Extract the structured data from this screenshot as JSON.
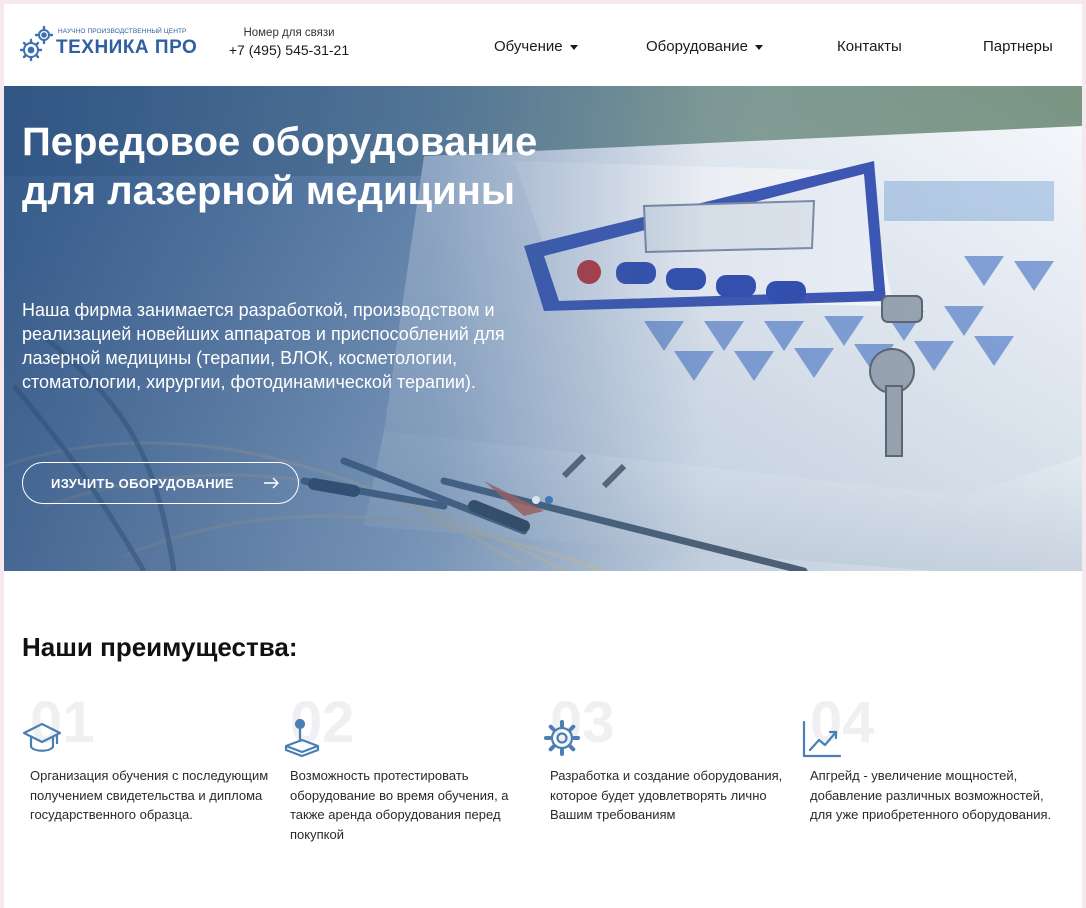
{
  "header": {
    "logo": {
      "small": "НАУЧНО ПРОИЗВОДСТВЕННЫЙ ЦЕНТР",
      "big": "ТЕХНИКА ПРО"
    },
    "phone_caption": "Номер для связи",
    "phone_number": "+7 (495) 545-31-21",
    "nav": [
      {
        "label": "Обучение",
        "dropdown": true
      },
      {
        "label": "Оборудование",
        "dropdown": true
      },
      {
        "label": "Контакты",
        "dropdown": false
      },
      {
        "label": "Партнеры",
        "dropdown": false
      }
    ]
  },
  "hero": {
    "title": "Передовое оборудование для лазерной медицины",
    "text": "Наша фирма занимается разработкой, производством и реализацией новейших аппаратов и приспособлений для лазерной медицины (терапии, ВЛОК, косметологии, стоматологии, хирургии, фотодинамической терапии).",
    "button_label": "ИЗУЧИТЬ ОБОРУДОВАНИЕ",
    "slides_count": 2,
    "active_slide": 2
  },
  "advantages": {
    "title": "Наши преимущества:",
    "items": [
      {
        "num": "01",
        "icon": "graduation-cap-icon",
        "text": "Организация обучения с последующим получением свидетельства и диплома государственного образца."
      },
      {
        "num": "02",
        "icon": "joystick-icon",
        "text": "Возможность протестировать оборудование во время обучения, а также аренда оборудования перед покупкой"
      },
      {
        "num": "03",
        "icon": "gear-icon",
        "text": "Разработка и создание оборудования, которое будет удовлетворять лично Вашим требованиям"
      },
      {
        "num": "04",
        "icon": "growth-chart-icon",
        "text": "Апгрейд - увеличение мощностей, добавление различных возможностей, для уже приобретенного оборудования."
      }
    ]
  },
  "colors": {
    "brand": "#2e5fa3",
    "icon": "#4a7fb5",
    "hero_overlay": "#284e80",
    "dot_inactive": "#d9e6f2",
    "dot_active": "#3f78b5"
  }
}
